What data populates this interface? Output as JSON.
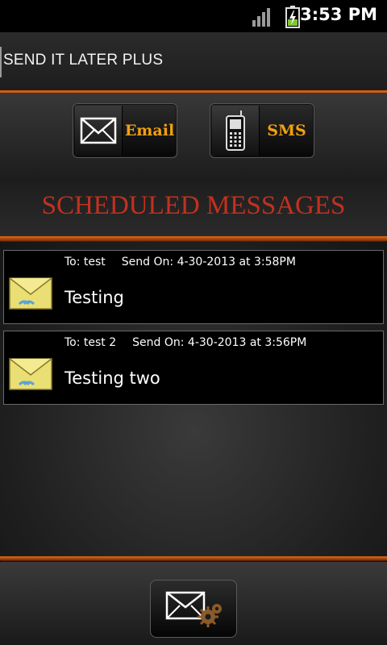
{
  "status": {
    "time": "3:53 PM"
  },
  "app": {
    "title": "SEND IT LATER PLUS"
  },
  "buttons": {
    "email_label": "Email",
    "sms_label": "SMS"
  },
  "section": {
    "heading": "SCHEDULED MESSAGES"
  },
  "messages": [
    {
      "to": "To: test",
      "send_on": "Send On: 4-30-2013 at 3:58PM",
      "body": "Testing"
    },
    {
      "to": "To: test 2",
      "send_on": "Send On: 4-30-2013 at 3:56PM",
      "body": "Testing two"
    }
  ],
  "colors": {
    "accent": "#d55a10",
    "button_label": "#f1a010",
    "heading": "#c3301f"
  },
  "icons": [
    "signal-icon",
    "battery-charging-icon",
    "email-icon",
    "phone-icon",
    "envelope-icon",
    "compose-settings-icon"
  ]
}
